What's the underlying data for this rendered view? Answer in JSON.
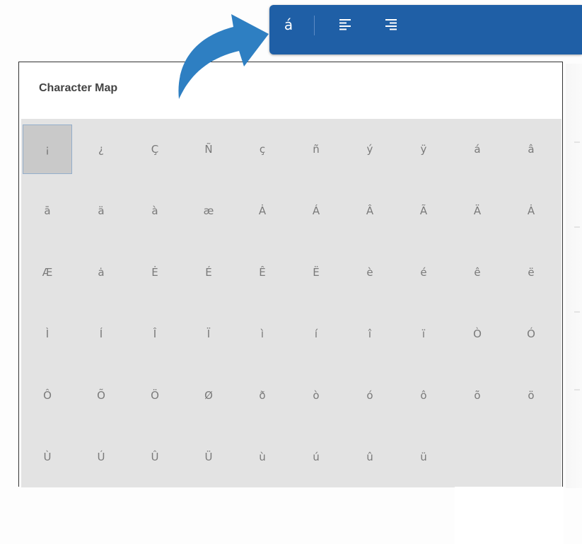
{
  "toolbar": {
    "character_button": "á"
  },
  "character_map": {
    "title": "Character Map",
    "selected": "¡",
    "rows": [
      [
        "¡",
        "¿",
        "Ç",
        "Ñ",
        "ç",
        "ñ",
        "ý",
        "ÿ",
        "á",
        "â"
      ],
      [
        "ā",
        "ä",
        "à",
        "æ",
        "Ȧ",
        "Á",
        "Â",
        "Ã",
        "Ä",
        "Ȧ"
      ],
      [
        "Æ",
        "ȧ",
        "Ė",
        "É",
        "Ê",
        "Ë",
        "è",
        "é",
        "ê",
        "ë"
      ],
      [
        "Ì",
        "Í",
        "Î",
        "Ï",
        "ì",
        "í",
        "î",
        "ï",
        "Ò",
        "Ó"
      ],
      [
        "Ô",
        "Õ",
        "Ö",
        "Ø",
        "ð",
        "ò",
        "ó",
        "ô",
        "õ",
        "ö"
      ],
      [
        "Ù",
        "Ú",
        "Û",
        "Ü",
        "ù",
        "ú",
        "û",
        "ü"
      ]
    ]
  },
  "colors": {
    "toolbar": "#1f5fa6",
    "arrow": "#2e7fc2",
    "grid": "#e3e3e3"
  }
}
